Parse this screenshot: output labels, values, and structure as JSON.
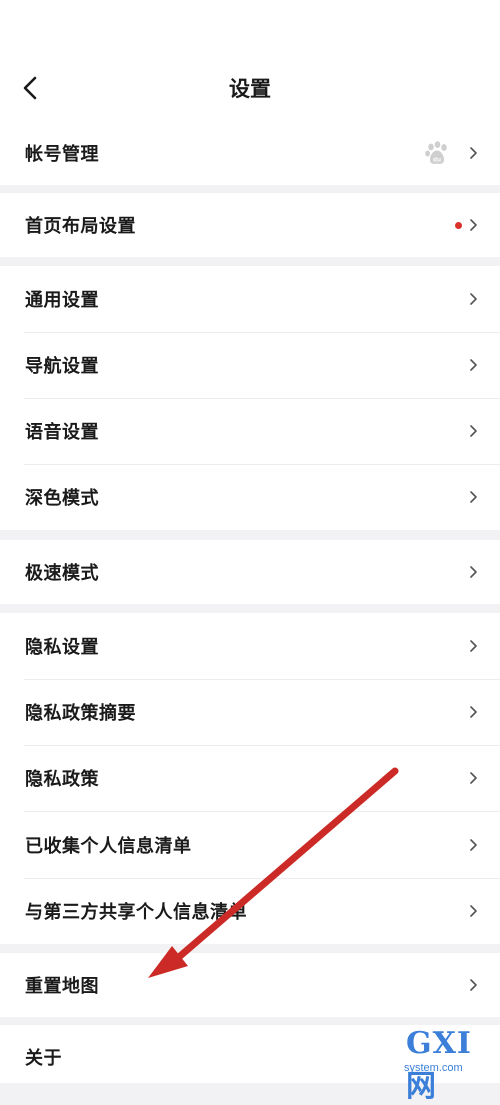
{
  "header": {
    "title": "设置",
    "back_icon": "chevron-left-icon"
  },
  "colors": {
    "accent_red": "#d9322b",
    "arrow_red": "#cc2a26",
    "background": "#f2f2f4",
    "row_background": "#ffffff",
    "watermark_blue": "#3b7fd9"
  },
  "groups": [
    {
      "items": [
        {
          "label": "帐号管理",
          "accessory": "baidu-paw-icon"
        }
      ]
    },
    {
      "items": [
        {
          "label": "首页布局设置",
          "accessory": "red-dot-badge"
        }
      ]
    },
    {
      "items": [
        {
          "label": "通用设置"
        },
        {
          "label": "导航设置"
        },
        {
          "label": "语音设置"
        },
        {
          "label": "深色模式"
        }
      ]
    },
    {
      "items": [
        {
          "label": "极速模式"
        }
      ]
    },
    {
      "items": [
        {
          "label": "隐私设置"
        },
        {
          "label": "隐私政策摘要"
        },
        {
          "label": "隐私政策"
        },
        {
          "label": "已收集个人信息清单"
        },
        {
          "label": "与第三方共享个人信息清单"
        }
      ]
    },
    {
      "items": [
        {
          "label": "重置地图"
        }
      ]
    },
    {
      "items": [
        {
          "label": "关于"
        }
      ]
    }
  ],
  "annotation": {
    "arrow_target": "重置地图"
  },
  "watermark": {
    "logo": "GXI网",
    "domain": "system.com"
  }
}
